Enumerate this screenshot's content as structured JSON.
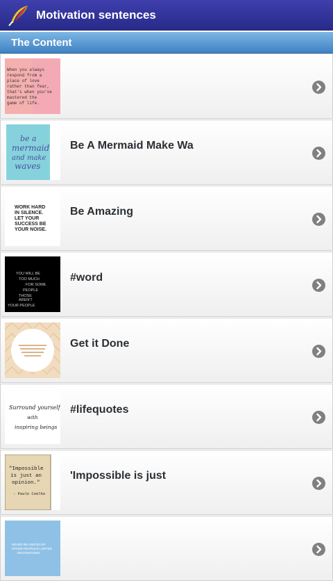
{
  "app": {
    "title": "Motivation sentences",
    "logo": "feather-pen-icon"
  },
  "section": {
    "title": "The Content"
  },
  "items": [
    {
      "label": "",
      "thumb_text": "When you always respond from a place of love rather than fear, that's when you've mastered the game of life.",
      "thumb_bg": "#f2a5a5"
    },
    {
      "label": "Be A Mermaid Make Wa",
      "thumb_text": "be a mermaid and make waves",
      "thumb_bg": "#86d2dc"
    },
    {
      "label": "Be Amazing",
      "thumb_text": "WORK HARD IN SILENCE. LET YOUR SUCCESS BE YOUR NOISE.",
      "thumb_bg": "#ffffff"
    },
    {
      "label": "#word",
      "thumb_text": "YOU WILL BE TOO MUCH FOR SOME PEOPLE THOSE AREN'T YOUR PEOPLE",
      "thumb_bg": "#000000"
    },
    {
      "label": "Get it Done",
      "thumb_text": "",
      "thumb_bg": "#f4e7d6"
    },
    {
      "label": "#lifequotes",
      "thumb_text": "Surround yourself with inspiring beings",
      "thumb_bg": "#ffffff"
    },
    {
      "label": "'Impossible is just",
      "thumb_text": "\"Impossible is just an opinion.\" - Paulo Coelho",
      "thumb_bg": "#e8d9b9"
    },
    {
      "label": "",
      "thumb_text": "NEVER BE LIMITED BY OTHER PEOPLE'S LIMITED IMAGINATIONS",
      "thumb_bg": "#8fc1e6"
    }
  ]
}
